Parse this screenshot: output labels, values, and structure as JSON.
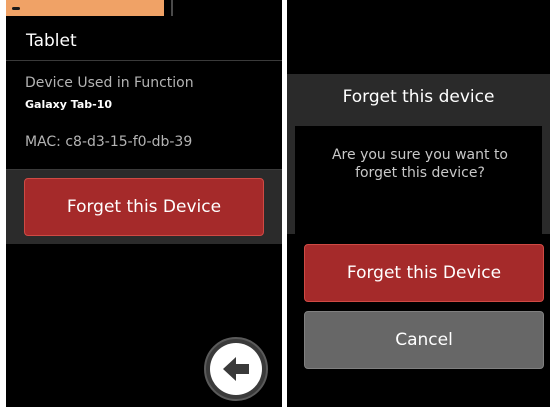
{
  "left_screen": {
    "device_title": "Tablet",
    "used_label": "Device Used in Function",
    "used_value": "Galaxy Tab-10",
    "mac": "MAC: c8-d3-15-f0-db-39",
    "forget_button": "Forget this Device",
    "back_icon": "arrow-left-icon"
  },
  "right_screen": {
    "dialog_title": "Forget this device",
    "dialog_message": "Are you sure you want to forget this device?",
    "forget_button": "Forget this Device",
    "cancel_button": "Cancel"
  },
  "colors": {
    "accent_red": "#a52a2a",
    "status_strip": "#f0a266",
    "cancel_grey": "#676767"
  }
}
